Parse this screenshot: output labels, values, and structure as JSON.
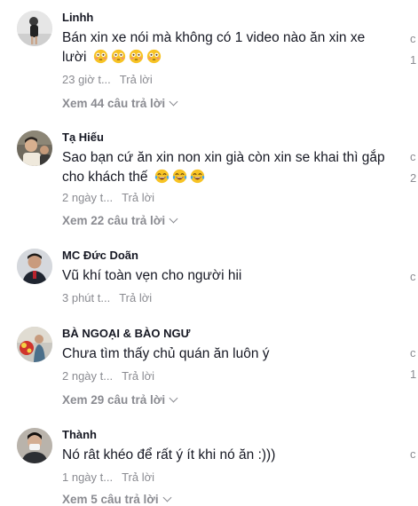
{
  "comments": [
    {
      "username": "Linhh",
      "text": "Bán xin xe nói mà không có 1 video nào ăn xin xe lười",
      "emoji": "😳 😳 😳 😳",
      "time": "23 giờ t...",
      "reply": "Trả lời",
      "view_replies": "Xem 44 câu trả lời",
      "like_count": "1"
    },
    {
      "username": "Tạ Hiếu",
      "text": "Sao bạn cứ ăn xin non xin già còn xin se khai thì gắp cho khách thế",
      "emoji": "😂 😂 😂",
      "time": "2 ngày t...",
      "reply": "Trả lời",
      "view_replies": "Xem 22 câu trả lời",
      "like_count": "2"
    },
    {
      "username": "MC Đức Doãn",
      "text": "Vũ khí toàn vẹn cho người hii",
      "time": "3 phút t...",
      "reply": "Trả lời"
    },
    {
      "username": "BÀ NGOẠI & BÀO NGƯ",
      "text": "Chưa tìm thấy chủ quán ăn luôn ý",
      "time": "2 ngày t...",
      "reply": "Trả lời",
      "view_replies": "Xem 29 câu trả lời",
      "like_count": "1"
    },
    {
      "username": "Thành",
      "text": "Nó rât khéo để rất ý ít khi nó ăn :)))",
      "time": "1 ngày t...",
      "reply": "Trả lời",
      "view_replies": "Xem 5 câu trả lời"
    }
  ],
  "colors": {
    "username": "#161823",
    "secondary": "#8a8b91",
    "background": "#ffffff"
  },
  "icons": {
    "like": "heart-outline-icon",
    "expand": "chevron-down-icon",
    "flushed_emoji": "flushed-face-icon",
    "laugh_emoji": "tears-of-joy-icon"
  }
}
